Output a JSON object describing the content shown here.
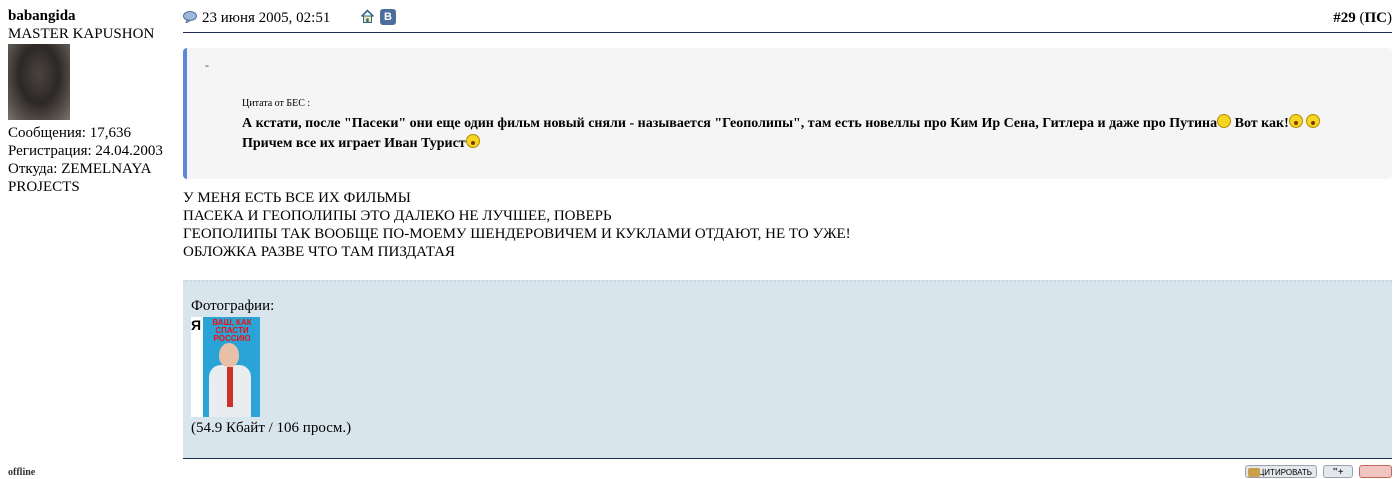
{
  "user": {
    "name": "babangida",
    "title": "MASTER KAPUSHON",
    "posts_label": "Сообщения: 17,636",
    "registered_label": "Регистрация: 24.04.2003",
    "location_label": "Откуда: ZEMELNAYA PROJECTS",
    "status": "offline"
  },
  "header": {
    "date": "23 июня 2005, 02:51",
    "post_number": "#29",
    "ps_open": " (",
    "ps": "ПС",
    "ps_close": ")",
    "vk_letter": "В"
  },
  "quote": {
    "dash": "-",
    "label": "Цитата от БЕС :",
    "text_1": "А кстати, после \"Пасеки\" они еще один фильм новый сняли - называется \"Геополипы\", там есть новеллы про Ким Ир Сена, Гитлера и даже про Путина",
    "text_2": " Вот как!",
    "text_3": "Причем все их играет Иван Турист"
  },
  "message": {
    "lines": [
      "У МЕНЯ ЕСТЬ ВСЕ ИХ ФИЛЬМЫ",
      "ПАСЕКА И ГЕОПОЛИПЫ ЭТО ДАЛЕКО НЕ ЛУЧШЕЕ, ПОВЕРЬ",
      "ГЕОПОЛИПЫ ТАК ВООБЩЕ ПО-МОЕМУ ШЕНДЕРОВИЧЕМ И КУКЛАМИ ОТДАЮТ, НЕ ТО УЖЕ!",
      "ОБЛОЖКА РАЗВЕ ЧТО ТАМ ПИЗДАТАЯ"
    ]
  },
  "attachment": {
    "title": "Фотографии:",
    "cover_spine": "Я",
    "cover_title": "ВАШ, КАК СПАСТИ РОССИЮ",
    "size": "(54.9 Кбайт / 106 просм.)"
  },
  "buttons": {
    "quote": "ЦИТИРОВАТЬ",
    "multi": "\"+"
  },
  "colors": {
    "quote_border": "#5a8ad6",
    "attachment_bg": "#d9e5ec",
    "rule": "#1f2a50"
  }
}
